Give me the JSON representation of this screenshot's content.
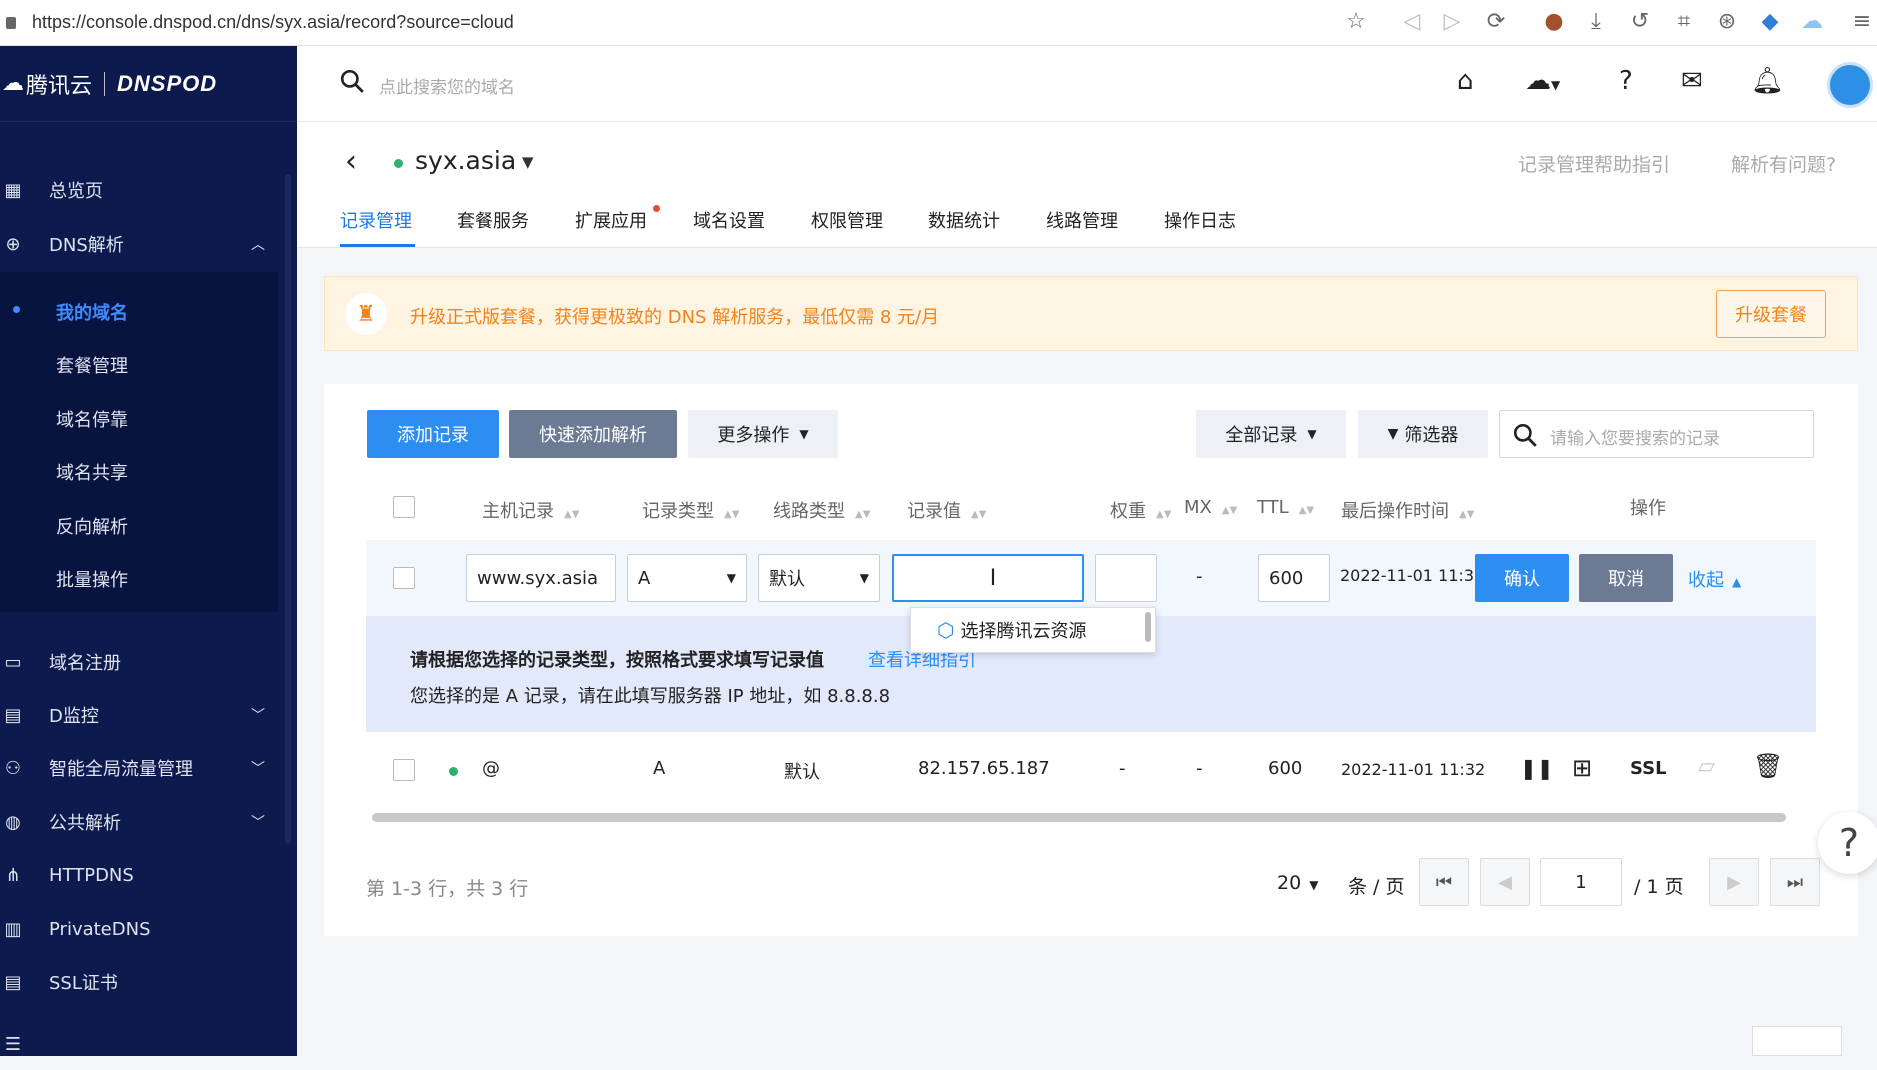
{
  "browser": {
    "url": "https://console.dnspod.cn/dns/syx.asia/record?source=cloud"
  },
  "brand": {
    "name1": "腾讯云",
    "name2": "DNSPOD"
  },
  "sidebar": {
    "items": [
      {
        "label": "总览页",
        "icon": "grid-icon"
      },
      {
        "label": "DNS解析",
        "icon": "globe-icon"
      },
      {
        "label": "域名注册",
        "icon": "calendar-icon"
      },
      {
        "label": "D监控",
        "icon": "monitor-icon"
      },
      {
        "label": "智能全局流量管理",
        "icon": "share-icon"
      },
      {
        "label": "公共解析",
        "icon": "globe-alt-icon"
      },
      {
        "label": "HTTPDNS",
        "icon": "nodes-icon"
      },
      {
        "label": "PrivateDNS",
        "icon": "building-icon"
      },
      {
        "label": "SSL证书",
        "icon": "certificate-icon"
      }
    ],
    "sub_items": [
      "我的域名",
      "套餐管理",
      "域名停靠",
      "域名共享",
      "反向解析",
      "批量操作"
    ]
  },
  "topbar": {
    "search_placeholder": "点此搜索您的域名"
  },
  "header": {
    "domain": "syx.asia",
    "help1": "记录管理帮助指引",
    "help2": "解析有问题?",
    "tabs": [
      "记录管理",
      "套餐服务",
      "扩展应用",
      "域名设置",
      "权限管理",
      "数据统计",
      "线路管理",
      "操作日志"
    ]
  },
  "banner": {
    "text": "升级正式版套餐，获得更极致的 DNS 解析服务，最低仅需 8 元/月",
    "button": "升级套餐"
  },
  "toolbar": {
    "add": "添加记录",
    "quick_add": "快速添加解析",
    "more": "更多操作",
    "all_records": "全部记录",
    "filter": "筛选器",
    "search_placeholder": "请输入您要搜索的记录"
  },
  "table": {
    "headers": [
      "主机记录",
      "记录类型",
      "线路类型",
      "记录值",
      "权重",
      "MX",
      "TTL",
      "最后操作时间",
      "操作"
    ],
    "edit": {
      "host": "www.syx.asia",
      "type": "A",
      "line": "默认",
      "value": "",
      "weight": "",
      "mx": "-",
      "ttl": "600",
      "time": "2022-11-01 11:32",
      "confirm": "确认",
      "cancel": "取消",
      "collapse": "收起"
    },
    "popup": "选择腾讯云资源",
    "guide": {
      "title": "请根据您选择的记录类型，按照格式要求填写记录值",
      "link": "查看详细指引",
      "desc": "您选择的是 A 记录，请在此填写服务器 IP 地址，如 8.8.8.8"
    },
    "rows": [
      {
        "host": "@",
        "type": "A",
        "line": "默认",
        "value": "82.157.65.187",
        "weight": "-",
        "mx": "-",
        "ttl": "600",
        "time": "2022-11-01 11:32",
        "ssl": "SSL"
      }
    ]
  },
  "pagination": {
    "summary": "第 1-3 行，共 3 行",
    "page_size": "20",
    "per_page": "条 / 页",
    "page": "1",
    "total": "/ 1 页"
  },
  "float_help": "?"
}
